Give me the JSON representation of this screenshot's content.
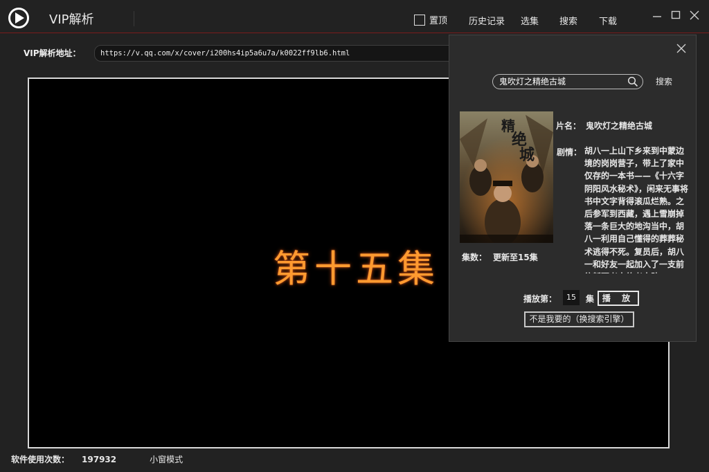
{
  "app": {
    "title": "VIP解析",
    "icon": "play-icon"
  },
  "menu": {
    "pin_label": "置顶",
    "history_label": "历史记录",
    "episodes_label": "选集",
    "search_label": "搜索",
    "download_label": "下载"
  },
  "window": {
    "minimize_icon": "minimize-icon",
    "maximize_icon": "maximize-icon",
    "close_icon": "close-icon"
  },
  "url": {
    "label": "VIP解析地址：",
    "value": "https://v.qq.com/x/cover/i200hs4ip5a6u7a/k0022ff9lb6.html"
  },
  "player": {
    "overlay_text": "第十五集"
  },
  "status": {
    "usage_label": "软件使用次数：",
    "usage_count": "197932",
    "mini_mode_label": "小窗模式"
  },
  "search_panel": {
    "query": "鬼吹灯之精绝古城",
    "search_button": "搜索",
    "result": {
      "name_label": "片名：",
      "name": "鬼吹灯之精绝古城",
      "plot_label": "剧情：",
      "plot": "胡八一上山下乡来到中蒙边境的岗岗营子，带上了家中仅存的一本书——《十六字阴阳风水秘术》，闲来无事将书中文字背得滚瓜烂熟。之后参军到西藏，遇上雪崩掉落一条巨大的地沟当中，胡八一利用自己懂得的葬葬秘术逃得不死。复员后，胡八一和好友一起加入了一支前往新疆考古的考古队。一",
      "episodes_label": "集数：",
      "episodes_value": "更新至15集"
    },
    "play_from_label": "播放第：",
    "episode_number": "15",
    "episode_unit": "集",
    "play_button": "播 放",
    "switch_engine_button": "不是我要的（换搜索引擎）"
  },
  "colors": {
    "background": "#222222",
    "panel": "#2c2c2c",
    "accent_line": "#7a1c1c",
    "episode_text": "#ff9a30"
  }
}
